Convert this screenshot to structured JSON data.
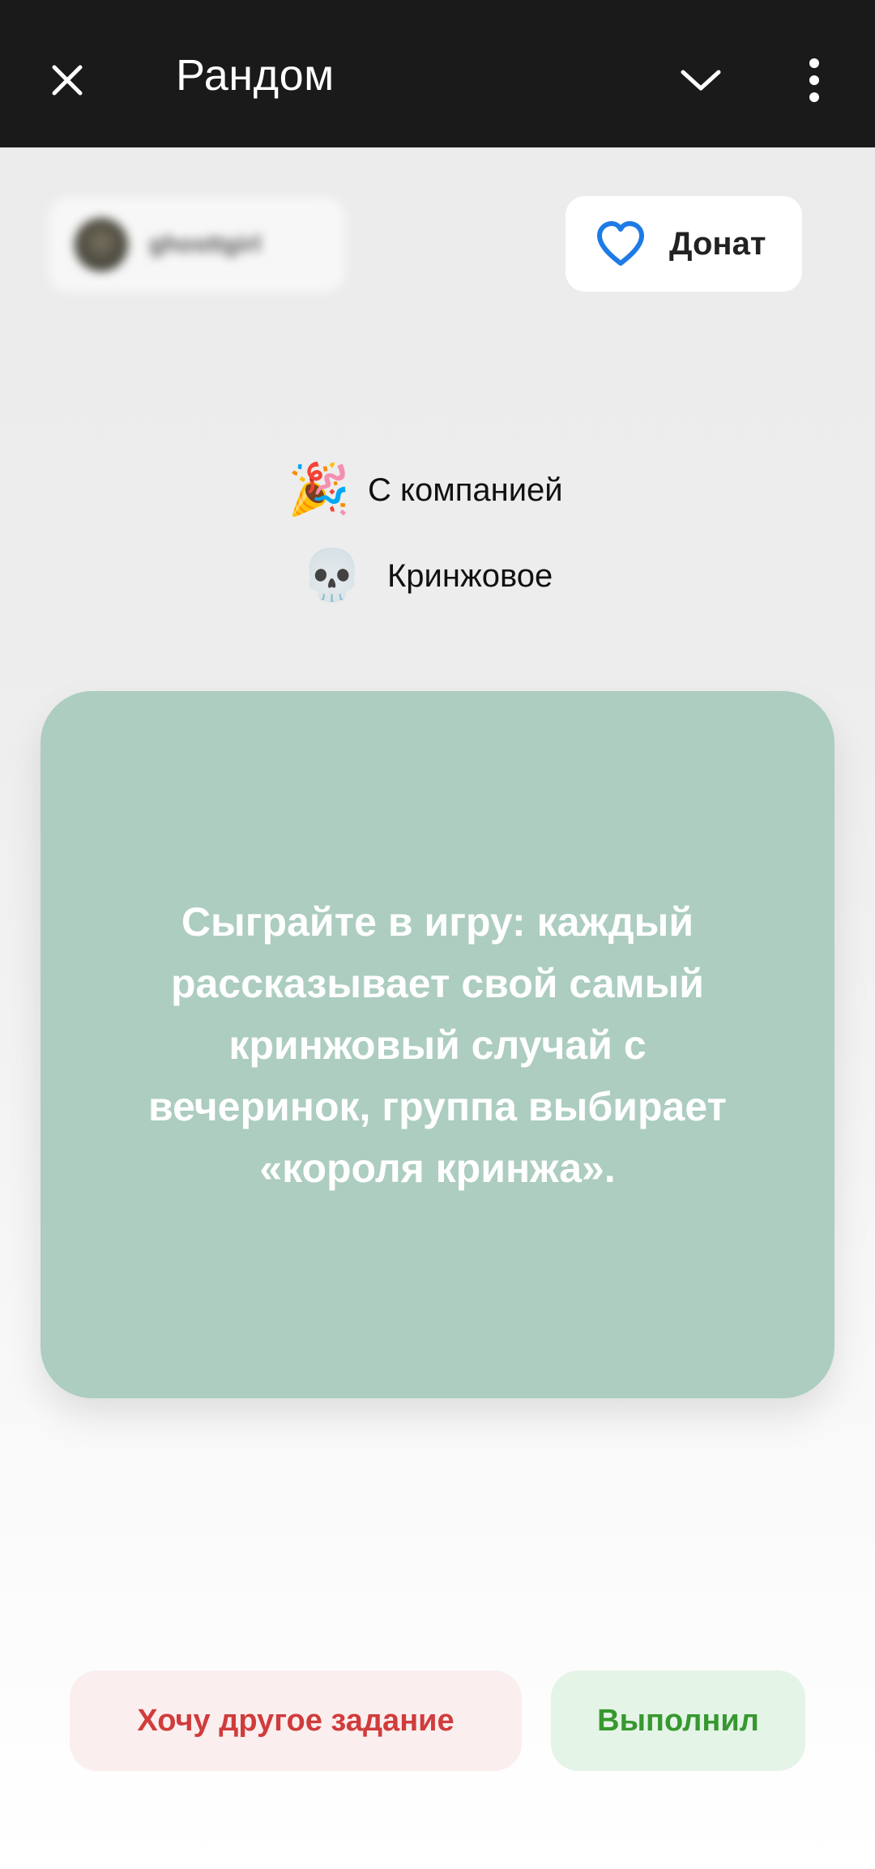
{
  "header": {
    "title": "Рандом",
    "close_icon": "close-icon",
    "chevron_icon": "chevron-down-icon",
    "more_icon": "more-vertical-icon"
  },
  "user": {
    "username": "ghosttgirl"
  },
  "donate": {
    "label": "Донат",
    "icon": "heart-icon",
    "icon_color": "#1e7be6"
  },
  "tags": [
    {
      "emoji": "🎉",
      "label": "С компанией"
    },
    {
      "emoji": "💀",
      "label": "Кринжовое"
    }
  ],
  "task": {
    "text": "Сыграйте в игру: каждый рассказывает свой самый кринжовый случай с вечеринок, группа выбирает «короля кринжа».",
    "card_color": "#accdbf"
  },
  "actions": {
    "other_label": "Хочу другое задание",
    "other_color": "#d03c3c",
    "done_label": "Выполнил",
    "done_color": "#37982f"
  }
}
